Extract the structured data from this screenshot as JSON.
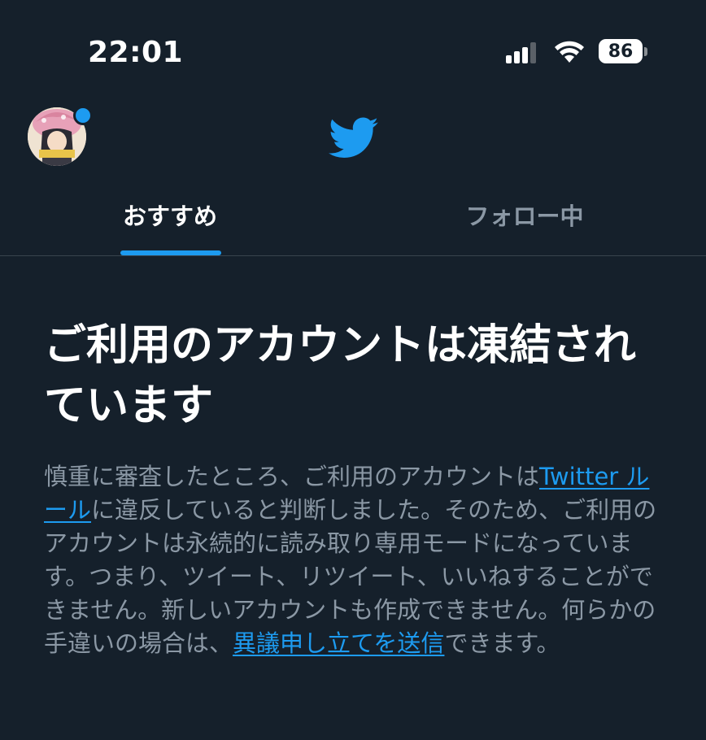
{
  "status_bar": {
    "time": "22:01",
    "battery_level": "86",
    "icons": [
      "signal-icon",
      "wifi-icon",
      "battery-icon"
    ]
  },
  "header": {
    "avatar_icon": "profile-avatar",
    "logo_icon": "twitter-bird-icon"
  },
  "tabs": [
    {
      "label": "おすすめ",
      "active": true
    },
    {
      "label": "フォロー中",
      "active": false
    }
  ],
  "notice": {
    "title": "ご利用のアカウントは凍結されています",
    "body_part1": "慎重に審査したところ、ご利用のアカウントは",
    "rules_link": "Twitter ルール",
    "body_part2": "に違反していると判断しました。そのため、ご利用のアカウントは永続的に読み取り専用モードになっています。つまり、ツイート、リツイート、いいねすることができません。新しいアカウントも作成できません。何らかの手違いの場合は、",
    "appeal_link": "異議申し立てを送信",
    "body_part3": "できます。"
  },
  "colors": {
    "background": "#15202b",
    "accent": "#1d9bf0",
    "secondary_text": "#8b98a5",
    "divider": "#38444d"
  }
}
